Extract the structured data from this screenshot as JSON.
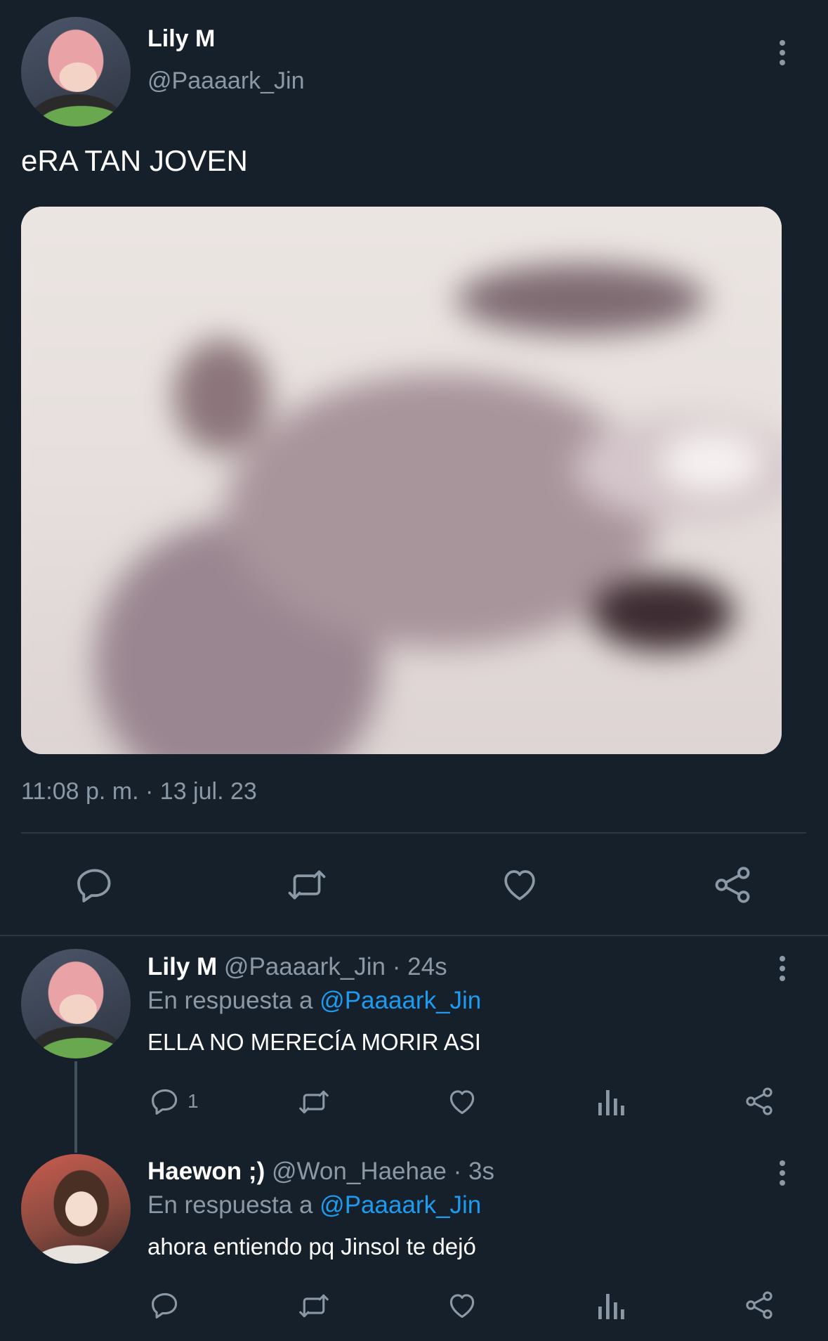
{
  "main_tweet": {
    "author_name": "Lily M",
    "author_handle": "@Paaaark_Jin",
    "text": "eRA TAN JOVEN",
    "timestamp": "11:08 p. m. · 13 jul. 23",
    "actions": [
      "reply-icon",
      "retweet-icon",
      "like-icon",
      "share-icon"
    ]
  },
  "replies": [
    {
      "author_name": "Lily M",
      "author_handle": "@Paaaark_Jin",
      "time": "· 24s",
      "reply_prefix": "En respuesta a",
      "reply_to": "@Paaaark_Jin",
      "text": "ELLA NO MERECÍA MORIR ASI",
      "reply_count": "1"
    },
    {
      "author_name": "Haewon ;)",
      "author_handle": "@Won_Haehae",
      "time": "· 3s",
      "reply_prefix": "En respuesta a",
      "reply_to": "@Paaaark_Jin",
      "text": "ahora entiendo pq Jinsol te dejó",
      "reply_count": ""
    }
  ],
  "colors": {
    "background": "#15202b",
    "text": "#ffffff",
    "muted": "#8b98a5",
    "accent": "#1d9bf0",
    "divider": "#2c3742"
  }
}
